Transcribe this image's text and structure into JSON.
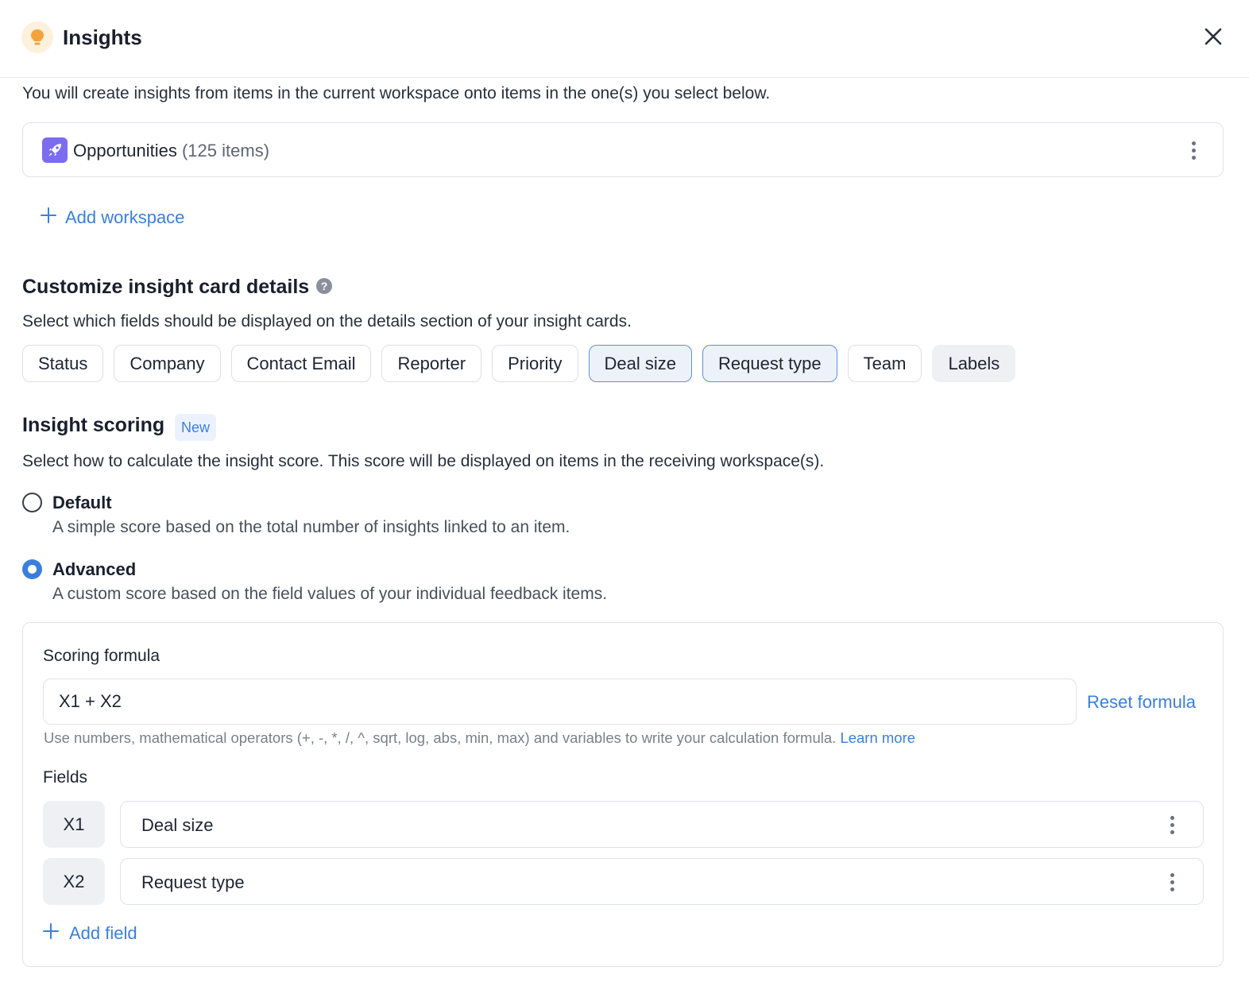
{
  "header": {
    "title": "Insights",
    "icon": "lightbulb-icon",
    "accent": "#f3a33c"
  },
  "intro": "You will create insights from items in the current workspace onto items in the one(s) you select below.",
  "workspaces": [
    {
      "name": "Opportunities",
      "count": "(125 items)",
      "icon": "rocket-icon",
      "color": "#7b6cf0"
    }
  ],
  "add_workspace_label": "Add workspace",
  "card_details": {
    "title": "Customize insight card details",
    "description": "Select which fields should be displayed on the details section of your insight cards.",
    "fields": [
      {
        "label": "Status",
        "state": "default"
      },
      {
        "label": "Company",
        "state": "default"
      },
      {
        "label": "Contact Email",
        "state": "default"
      },
      {
        "label": "Reporter",
        "state": "default"
      },
      {
        "label": "Priority",
        "state": "default"
      },
      {
        "label": "Deal size",
        "state": "selected"
      },
      {
        "label": "Request type",
        "state": "selected"
      },
      {
        "label": "Team",
        "state": "default"
      },
      {
        "label": "Labels",
        "state": "muted"
      }
    ]
  },
  "scoring": {
    "title": "Insight scoring",
    "badge": "New",
    "description": "Select how to calculate the insight score. This score will be displayed on items in the receiving workspace(s).",
    "selected": "advanced",
    "options": [
      {
        "id": "default",
        "label": "Default",
        "description": "A simple score based on the total number of insights linked to an item."
      },
      {
        "id": "advanced",
        "label": "Advanced",
        "description": "A custom score based on the field values of your individual feedback items."
      }
    ],
    "formula_label": "Scoring formula",
    "formula_value": "X1 + X2",
    "reset_label": "Reset formula",
    "hint": "Use numbers, mathematical operators (+, -, *, /, ^, sqrt, log, abs, min, max) and variables to write your calculation formula.",
    "learn_more": "Learn more",
    "fields_label": "Fields",
    "fields": [
      {
        "var": "X1",
        "name": "Deal size"
      },
      {
        "var": "X2",
        "name": "Request type"
      }
    ],
    "add_field_label": "Add field"
  },
  "colors": {
    "link": "#3a7fe0",
    "selected_chip_bg": "#edf2fa",
    "selected_chip_border": "#5b8fe0"
  }
}
